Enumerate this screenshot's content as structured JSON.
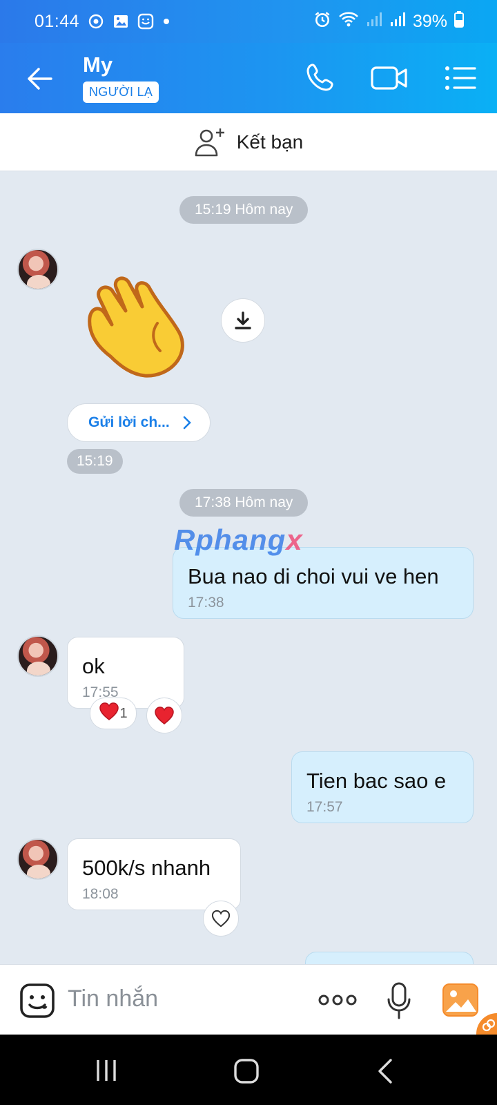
{
  "status_bar": {
    "time": "01:44",
    "battery": "39%"
  },
  "header": {
    "title": "My",
    "badge": "NGƯỜI LẠ"
  },
  "add_friend": {
    "label": "Kết bạn"
  },
  "chat": {
    "pill_1": "15:19 Hôm nay",
    "greeting_link": "Gửi lời ch...",
    "sticker_time": "15:19",
    "pill_2": "17:38 Hôm nay",
    "messages": [
      {
        "sender": "me",
        "text": "Bua nao di choi vui ve hen",
        "time": "17:38"
      },
      {
        "sender": "other",
        "text": "ok",
        "time": "17:55",
        "reaction_count": "1"
      },
      {
        "sender": "me",
        "text": "Tien bac sao e",
        "time": "17:57"
      },
      {
        "sender": "other",
        "text": "500k/s nhanh",
        "time": "18:08"
      }
    ]
  },
  "watermark": {
    "main": "Rphang",
    "suffix": "x"
  },
  "composer": {
    "placeholder": "Tin nhắn"
  },
  "colors": {
    "accent": "#1a7fe8",
    "my_bubble": "#d6effd",
    "background": "#e2e9f1"
  }
}
